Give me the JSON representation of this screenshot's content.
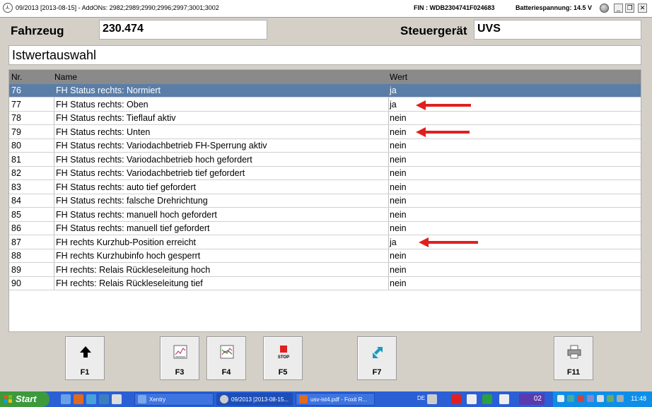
{
  "window": {
    "title": "09/2013 [2013-08-15] - AddONs: 2982;2989;2990;2996;2997;3001;3002",
    "fin": "FIN : WDB2304741F024683",
    "battery": "Batteriespannung: 14.5 V",
    "minimize": "_",
    "restore": "❐",
    "close": "✕"
  },
  "header": {
    "fahrzeug_label": "Fahrzeug",
    "fahrzeug_value": "230.474",
    "steuergeraet_label": "Steuergerät",
    "steuergeraet_value": "UVS",
    "selection_title": "Istwertauswahl"
  },
  "table": {
    "columns": [
      "Nr.",
      "Name",
      "Wert"
    ],
    "rows": [
      {
        "nr": "76",
        "name": "FH Status rechts: Normiert",
        "wert": "ja"
      },
      {
        "nr": "77",
        "name": "FH Status rechts: Oben",
        "wert": "ja"
      },
      {
        "nr": "78",
        "name": "FH Status rechts: Tieflauf aktiv",
        "wert": "nein"
      },
      {
        "nr": "79",
        "name": "FH Status rechts: Unten",
        "wert": "nein"
      },
      {
        "nr": "80",
        "name": "FH Status rechts: Variodachbetrieb FH-Sperrung aktiv",
        "wert": "nein"
      },
      {
        "nr": "81",
        "name": "FH Status rechts: Variodachbetrieb hoch gefordert",
        "wert": "nein"
      },
      {
        "nr": "82",
        "name": "FH Status rechts: Variodachbetrieb tief gefordert",
        "wert": "nein"
      },
      {
        "nr": "83",
        "name": "FH Status rechts: auto tief gefordert",
        "wert": "nein"
      },
      {
        "nr": "84",
        "name": "FH Status rechts: falsche Drehrichtung",
        "wert": "nein"
      },
      {
        "nr": "85",
        "name": "FH Status rechts: manuell hoch gefordert",
        "wert": "nein"
      },
      {
        "nr": "86",
        "name": "FH Status rechts: manuell tief gefordert",
        "wert": "nein"
      },
      {
        "nr": "87",
        "name": "FH rechts Kurzhub-Position erreicht",
        "wert": "ja"
      },
      {
        "nr": "88",
        "name": "FH rechts Kurzhubinfo hoch gesperrt",
        "wert": "nein"
      },
      {
        "nr": "89",
        "name": "FH rechts: Relais Rückleseleitung hoch",
        "wert": "nein"
      },
      {
        "nr": "90",
        "name": "FH rechts: Relais Rückleseleitung tief",
        "wert": "nein"
      }
    ],
    "selected_row": "76",
    "highlight_color": "#5b7ea8",
    "arrow_color": "#e02020"
  },
  "function_keys": [
    {
      "label": "F1",
      "icon": "arrow-up-icon"
    },
    {
      "label": "F3",
      "icon": "chart-icon"
    },
    {
      "label": "F4",
      "icon": "chart-compare-icon"
    },
    {
      "label": "F5",
      "icon": "stop-icon",
      "icon_text": "STOP"
    },
    {
      "label": "F7",
      "icon": "swap-icon"
    },
    {
      "label": "F11",
      "icon": "printer-icon"
    }
  ],
  "taskbar": {
    "start": "Start",
    "tasks": [
      {
        "label": "Xentry"
      },
      {
        "label": "09/2013 [2013-08-15..."
      },
      {
        "label": "usv-ist4.pdf - Foxit R..."
      }
    ],
    "lang": "DE",
    "counter": "02",
    "clock": "11:48"
  }
}
